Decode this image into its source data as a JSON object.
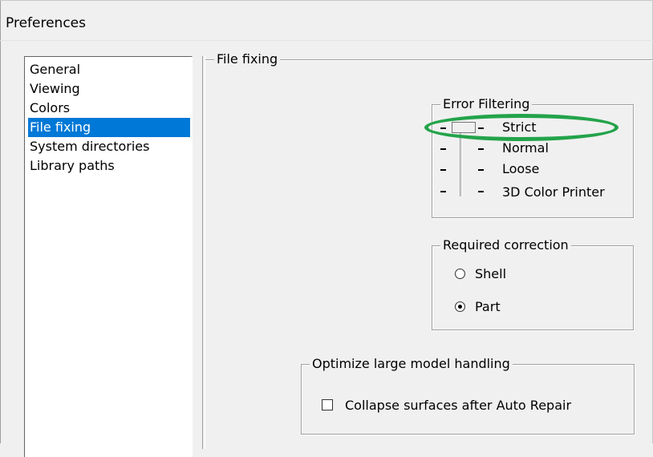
{
  "window": {
    "title": "Preferences"
  },
  "sidebar": {
    "items": [
      {
        "label": "General",
        "selected": false
      },
      {
        "label": "Viewing",
        "selected": false
      },
      {
        "label": "Colors",
        "selected": false
      },
      {
        "label": "File fixing",
        "selected": true
      },
      {
        "label": "System directories",
        "selected": false
      },
      {
        "label": "Library paths",
        "selected": false
      }
    ]
  },
  "panel": {
    "title": "File fixing",
    "error_filtering": {
      "label": "Error Filtering",
      "levels": [
        "Strict",
        "Normal",
        "Loose",
        "3D Color Printer"
      ],
      "selected": "Strict"
    },
    "required_correction": {
      "label": "Required correction",
      "options": [
        {
          "label": "Shell",
          "checked": false
        },
        {
          "label": "Part",
          "checked": true
        }
      ]
    },
    "optimize": {
      "label": "Optimize large model handling",
      "collapse_label": "Collapse surfaces after Auto Repair",
      "collapse_checked": false
    }
  },
  "colors": {
    "selection": "#0078d7",
    "highlight_annotation": "#23a34a"
  }
}
